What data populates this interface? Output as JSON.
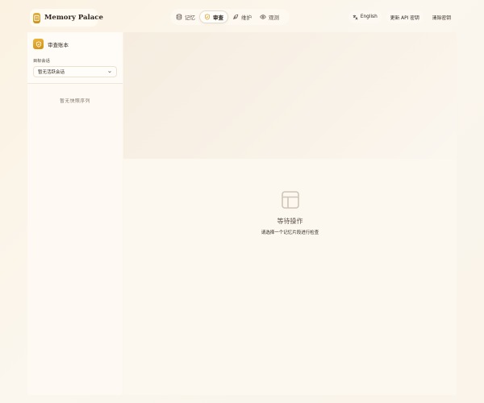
{
  "header": {
    "brand": {
      "title": "Memory Palace",
      "icon": "book-icon"
    },
    "nav": [
      {
        "label": "记忆",
        "icon": "database-icon",
        "active": false
      },
      {
        "label": "审查",
        "icon": "shield-icon",
        "active": true
      },
      {
        "label": "维护",
        "icon": "feather-icon",
        "active": false
      },
      {
        "label": "观测",
        "icon": "eye-icon",
        "active": false
      }
    ],
    "language_label": "English",
    "update_api_key_label": "更新 API 密钥",
    "clear_key_label": "清除密钥"
  },
  "sidebar": {
    "title": "审查账本",
    "target_session_label": "目标会话",
    "target_session_value": "暂无活跃会话",
    "empty_text": "暂无快照序列"
  },
  "main": {
    "empty_title": "等待操作",
    "empty_subtitle": "请选择一个记忆片段进行检查"
  },
  "colors": {
    "accent": "#d9a024",
    "background": "#fbf6ee"
  }
}
